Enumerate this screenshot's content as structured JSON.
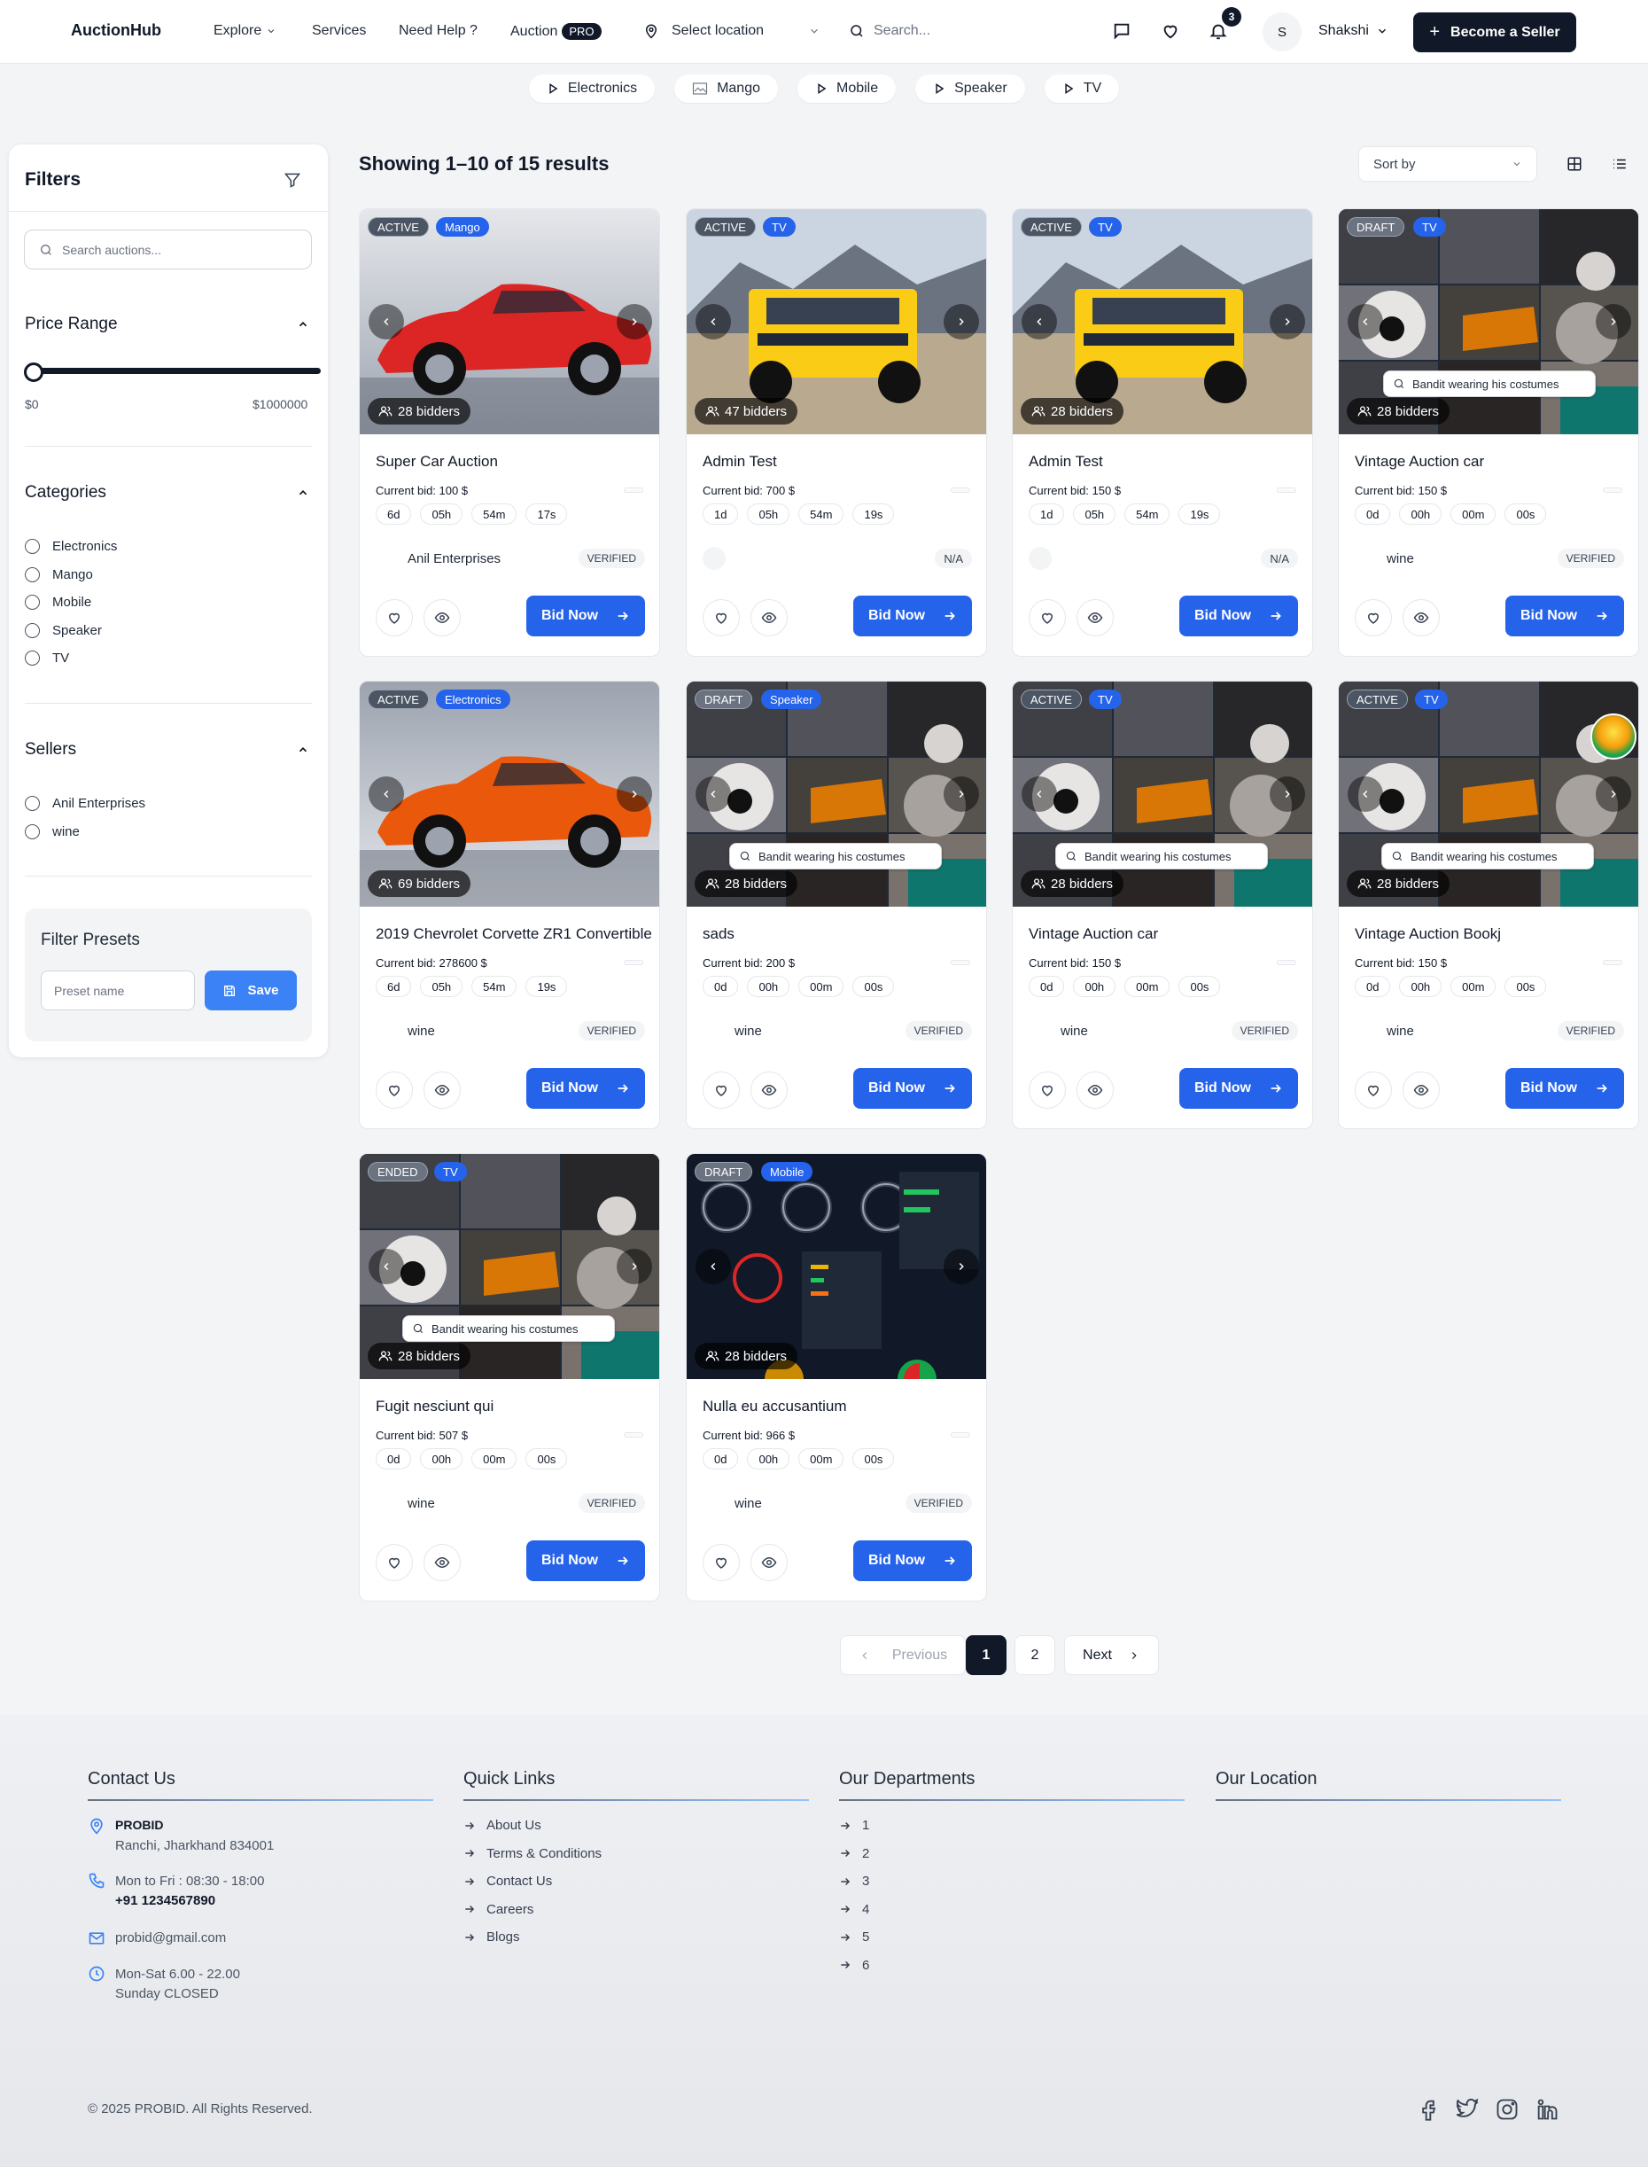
{
  "header": {
    "logo": "AuctionHub",
    "nav": [
      "Explore",
      "Services",
      "Need Help ?",
      "Auction"
    ],
    "pro_badge": "PRO",
    "location": "Select location",
    "search_placeholder": "Search...",
    "notification_count": "3",
    "avatar_initial": "S",
    "user_name": "Shakshi",
    "seller_button": "Become a Seller"
  },
  "category_chips": [
    "Electronics",
    "Mango",
    "Mobile",
    "Speaker",
    "TV"
  ],
  "sidebar": {
    "title": "Filters",
    "search_placeholder": "Search auctions...",
    "price_title": "Price Range",
    "price_min": "$0",
    "price_max": "$1000000",
    "price_slider_value": 0,
    "categories_title": "Categories",
    "categories": [
      "Electronics",
      "Mango",
      "Mobile",
      "Speaker",
      "TV"
    ],
    "sellers_title": "Sellers",
    "sellers": [
      "Anil Enterprises",
      "wine"
    ],
    "presets_title": "Filter Presets",
    "preset_placeholder": "Preset name",
    "save_label": "Save"
  },
  "results_text": "Showing 1–10 of 15 results",
  "sort_label": "Sort by",
  "cards": [
    {
      "status": "ACTIVE",
      "category": "Mango",
      "bidders": "28 bidders",
      "title": "Super Car Auction",
      "bid_label": "Current bid:",
      "bid": "100 $",
      "timer": [
        "6d",
        "05h",
        "54m",
        "17s"
      ],
      "seller": "Anil Enterprises",
      "badge": "VERIFIED",
      "bid_button": "Bid Now"
    },
    {
      "status": "ACTIVE",
      "category": "TV",
      "bidders": "47 bidders",
      "title": "Admin Test",
      "bid_label": "Current bid:",
      "bid": "700 $",
      "timer": [
        "1d",
        "05h",
        "54m",
        "19s"
      ],
      "seller": "",
      "badge": "N/A",
      "bid_button": "Bid Now"
    },
    {
      "status": "ACTIVE",
      "category": "TV",
      "bidders": "28 bidders",
      "title": "Admin Test",
      "bid_label": "Current bid:",
      "bid": "150 $",
      "timer": [
        "1d",
        "05h",
        "54m",
        "19s"
      ],
      "seller": "",
      "badge": "N/A",
      "bid_button": "Bid Now"
    },
    {
      "status": "DRAFT",
      "category": "TV",
      "bidders": "28 bidders",
      "title": "Vintage Auction car",
      "bid_label": "Current bid:",
      "bid": "150 $",
      "timer": [
        "0d",
        "00h",
        "00m",
        "00s"
      ],
      "seller": "wine",
      "badge": "VERIFIED",
      "bid_button": "Bid Now",
      "img_caption": "Bandit wearing his costumes"
    },
    {
      "status": "ACTIVE",
      "category": "Electronics",
      "bidders": "69 bidders",
      "title": "2019 Chevrolet Corvette ZR1 Convertible",
      "bid_label": "Current bid:",
      "bid": "278600 $",
      "timer": [
        "6d",
        "05h",
        "54m",
        "19s"
      ],
      "seller": "wine",
      "badge": "VERIFIED",
      "bid_button": "Bid Now"
    },
    {
      "status": "DRAFT",
      "category": "Speaker",
      "bidders": "28 bidders",
      "title": "sads",
      "bid_label": "Current bid:",
      "bid": "200 $",
      "timer": [
        "0d",
        "00h",
        "00m",
        "00s"
      ],
      "seller": "wine",
      "badge": "VERIFIED",
      "bid_button": "Bid Now",
      "img_caption": "Bandit wearing his costumes"
    },
    {
      "status": "ACTIVE",
      "category": "TV",
      "bidders": "28 bidders",
      "title": "Vintage Auction car",
      "bid_label": "Current bid:",
      "bid": "150 $",
      "timer": [
        "0d",
        "00h",
        "00m",
        "00s"
      ],
      "seller": "wine",
      "badge": "VERIFIED",
      "bid_button": "Bid Now",
      "img_caption": "Bandit wearing his costumes"
    },
    {
      "status": "ACTIVE",
      "category": "TV",
      "bidders": "28 bidders",
      "title": "Vintage Auction Bookj",
      "bid_label": "Current bid:",
      "bid": "150 $",
      "timer": [
        "0d",
        "00h",
        "00m",
        "00s"
      ],
      "seller": "wine",
      "badge": "VERIFIED",
      "bid_button": "Bid Now",
      "img_caption": "Bandit wearing his costumes"
    },
    {
      "status": "ENDED",
      "category": "TV",
      "bidders": "28 bidders",
      "title": "Fugit nesciunt qui",
      "bid_label": "Current bid:",
      "bid": "507 $",
      "timer": [
        "0d",
        "00h",
        "00m",
        "00s"
      ],
      "seller": "wine",
      "badge": "VERIFIED",
      "bid_button": "Bid Now",
      "img_caption": "Bandit wearing his costumes"
    },
    {
      "status": "DRAFT",
      "category": "Mobile",
      "bidders": "28 bidders",
      "title": "Nulla eu accusantium",
      "bid_label": "Current bid:",
      "bid": "966 $",
      "timer": [
        "0d",
        "00h",
        "00m",
        "00s"
      ],
      "seller": "wine",
      "badge": "VERIFIED",
      "bid_button": "Bid Now"
    }
  ],
  "pagination": {
    "previous": "Previous",
    "pages": [
      "1",
      "2"
    ],
    "next": "Next"
  },
  "footer": {
    "contact_title": "Contact Us",
    "company": "PROBID",
    "address": "Ranchi, Jharkhand 834001",
    "hours": "Mon to Fri : 08:30 - 18:00",
    "phone": "+91 1234567890",
    "email": "probid@gmail.com",
    "weekend_hours": "Mon-Sat 6.00 - 22.00",
    "sunday": "Sunday CLOSED",
    "links_title": "Quick Links",
    "links": [
      "About Us",
      "Terms & Conditions",
      "Contact Us",
      "Careers",
      "Blogs"
    ],
    "departments_title": "Our Departments",
    "departments": [
      "1",
      "2",
      "3",
      "4",
      "5",
      "6"
    ],
    "location_title": "Our Location",
    "copyright": "© 2025 PROBID. All Rights Reserved."
  }
}
